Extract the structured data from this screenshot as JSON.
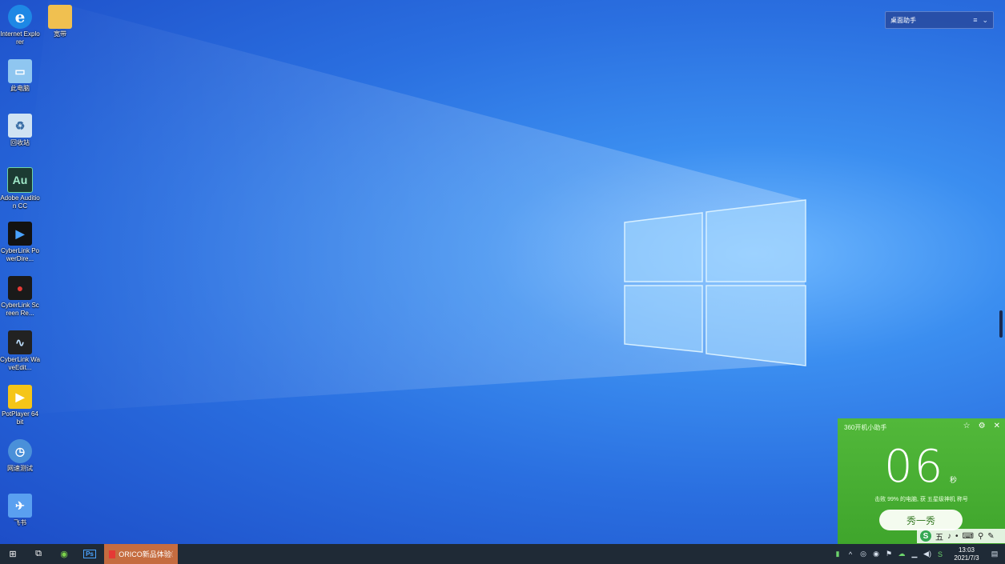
{
  "desktop_icons": [
    {
      "label": "Internet Explorer",
      "icon": "ie-icon",
      "color": "#1e88e5",
      "glyph": "e"
    },
    {
      "label": "宽带",
      "icon": "folder-icon",
      "color": "#f0c050",
      "glyph": ""
    },
    {
      "label": "此电脑",
      "icon": "computer-icon",
      "color": "#8fc6f0",
      "glyph": "▭"
    },
    {
      "label": "回收站",
      "icon": "recycle-bin-icon",
      "color": "#cfe3f3",
      "glyph": "♻"
    },
    {
      "label": "Adobe Audition CC",
      "icon": "audition-icon",
      "color": "#1c3b33",
      "glyph": "Au"
    },
    {
      "label": "CyberLink PowerDire...",
      "icon": "powerdirector-icon",
      "color": "#121212",
      "glyph": "▶"
    },
    {
      "label": "CyberLink Screen Re...",
      "icon": "screen-recorder-icon",
      "color": "#1a1a1a",
      "glyph": "●"
    },
    {
      "label": "CyberLink WaveEdit...",
      "icon": "waveeditor-icon",
      "color": "#222",
      "glyph": "∿"
    },
    {
      "label": "PotPlayer 64 bit",
      "icon": "potplayer-icon",
      "color": "#f5c518",
      "glyph": "▶"
    },
    {
      "label": "网速测试",
      "icon": "speedtest-icon",
      "color": "#4a90d9",
      "glyph": "◷"
    },
    {
      "label": "飞书",
      "icon": "feishu-icon",
      "color": "#5aa0f0",
      "glyph": "✈"
    }
  ],
  "top_widget": {
    "title": "桌面助手",
    "menu_glyph": "≡",
    "chevron_glyph": "⌄"
  },
  "panel360": {
    "title": "360开机小助手",
    "seconds": "06",
    "unit": "秒",
    "message": "击败 99% 的电脑, 获 五星级神机 称号",
    "button": "秀一秀",
    "controls": [
      "☆",
      "⚙",
      "✕"
    ]
  },
  "ime_bar": {
    "logo": "S",
    "items": [
      "五",
      "♪",
      "•",
      "⌨",
      "⚲",
      "✎"
    ]
  },
  "taskbar": {
    "start_glyph": "⊞",
    "taskview_glyph": "⧉",
    "apps": [
      {
        "name": "green-app",
        "glyph": "◉"
      },
      {
        "name": "ps",
        "glyph": "Ps"
      }
    ],
    "active_window": "ORICO新品体验②...",
    "tray_icons": [
      "▮",
      "^",
      "◎",
      "◉",
      "⚑",
      "☁",
      "▁",
      "◀)",
      "S"
    ],
    "time": "13:03",
    "date": "2021/7/3",
    "notification_glyph": "▤"
  }
}
